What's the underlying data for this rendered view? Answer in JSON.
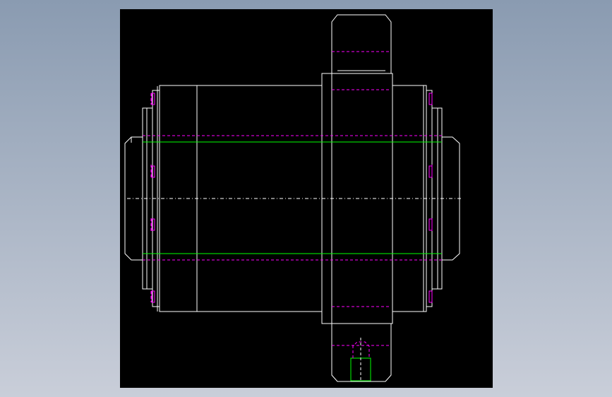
{
  "viewer": {
    "background_top": "#8a9bb1",
    "background_bottom": "#c9ced9"
  },
  "drawing": {
    "canvas_color": "#000000",
    "outline_color": "#ffffff",
    "hidden_line_color": "#ff00ff",
    "thread_line_color": "#00ff00",
    "centerline_color": "#ffffff"
  }
}
